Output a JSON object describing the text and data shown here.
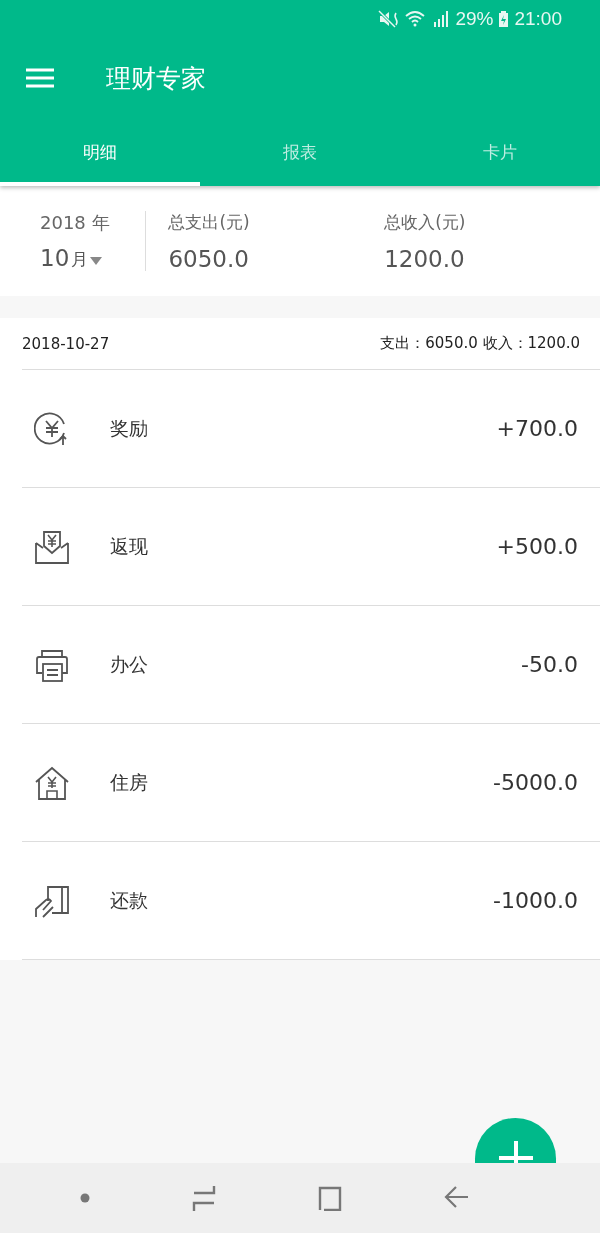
{
  "status_bar": {
    "battery": "29%",
    "time": "21:00"
  },
  "toolbar": {
    "title": "理财专家"
  },
  "tabs": [
    {
      "label": "明细",
      "selected": true
    },
    {
      "label": "报表",
      "selected": false
    },
    {
      "label": "卡片",
      "selected": false
    }
  ],
  "summary": {
    "year": "2018 年",
    "month": "10",
    "month_unit": "月",
    "expense_label": "总支出(元)",
    "expense": "6050.0",
    "income_label": "总收入(元)",
    "income": "1200.0"
  },
  "day": {
    "date": "2018-10-27",
    "totals": "支出：6050.0 收入：1200.0"
  },
  "entries": [
    {
      "kind": "bonus",
      "label": "奖励",
      "amount": "+700.0"
    },
    {
      "kind": "cashback",
      "label": "返现",
      "amount": "+500.0"
    },
    {
      "kind": "office",
      "label": "办公",
      "amount": "-50.0"
    },
    {
      "kind": "housing",
      "label": "住房",
      "amount": "-5000.0"
    },
    {
      "kind": "repayment",
      "label": "还款",
      "amount": "-1000.0"
    }
  ]
}
